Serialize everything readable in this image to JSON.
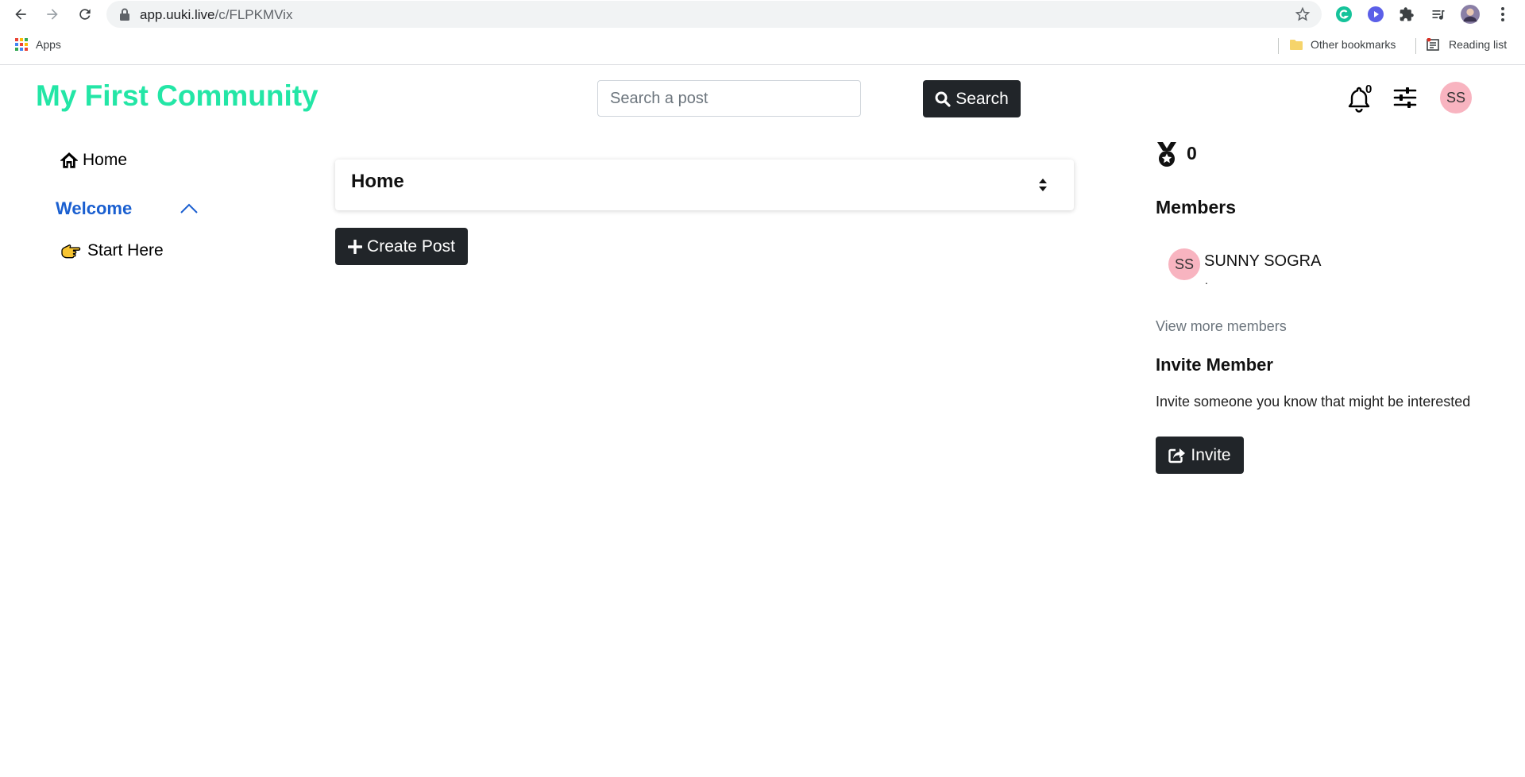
{
  "browser": {
    "url_host": "app.uuki.live",
    "url_path": "/c/FLPKMVix",
    "bookmarks": {
      "apps": "Apps",
      "other": "Other bookmarks",
      "reading_list": "Reading list"
    }
  },
  "header": {
    "brand": "My First Community",
    "search_placeholder": "Search a post",
    "search_button": "Search",
    "notification_count": "0",
    "user_initials": "SS"
  },
  "sidebar": {
    "home": "Home",
    "section": "Welcome",
    "items": [
      {
        "label": "Start Here"
      }
    ]
  },
  "main": {
    "space_select": "Home",
    "create_post": "Create Post"
  },
  "right": {
    "points": "0",
    "members_title": "Members",
    "members": [
      {
        "initials": "SS",
        "name": "SUNNY SOGRA",
        "subtitle": "."
      }
    ],
    "view_more": "View more members",
    "invite_title": "Invite Member",
    "invite_text": "Invite someone you know that might be interested",
    "invite_button": "Invite"
  },
  "colors": {
    "brand": "#23e6a6",
    "section_link": "#1a5fd0",
    "button_dark": "#212529",
    "avatar_bg": "#f8b4c0"
  }
}
